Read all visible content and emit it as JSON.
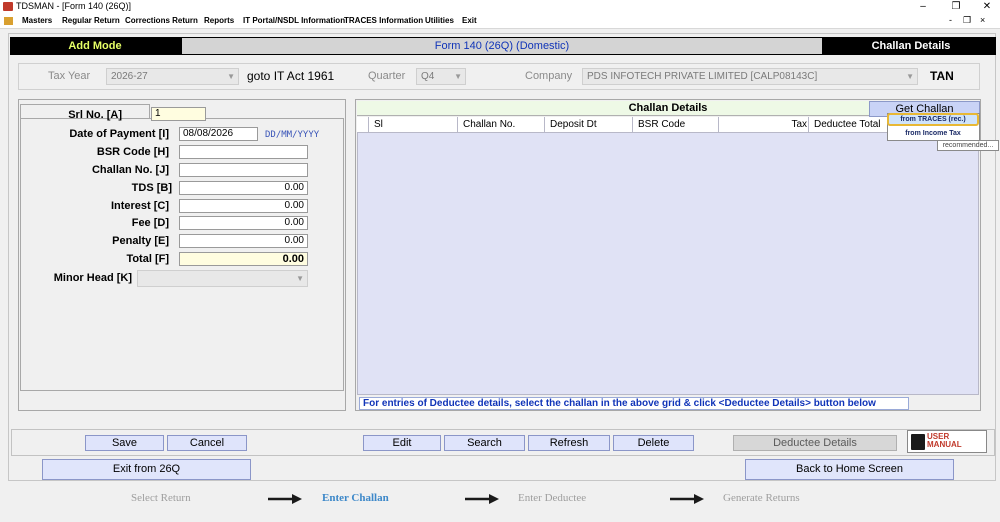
{
  "window": {
    "title": "TDSMAN - [Form 140 (26Q)]",
    "controls": {
      "minimize": "–",
      "restore": "❐",
      "close": "✕"
    },
    "mdi_controls": {
      "minimize": "-",
      "restore": "❐",
      "close": "×"
    }
  },
  "menu": [
    "Masters",
    "Regular Return",
    "Corrections Return",
    "Reports",
    "IT Portal/NSDL Information",
    "TRACES Information",
    "Utilities",
    "Exit"
  ],
  "header": {
    "mode": "Add Mode",
    "form": "Form 140 (26Q) (Domestic)",
    "section": "Challan Details"
  },
  "info": {
    "tax_year_label": "Tax Year",
    "tax_year_value": "2026-27",
    "goto_label": "goto IT Act 1961",
    "quarter_label": "Quarter",
    "quarter_value": "Q4",
    "company_label": "Company",
    "company_value": "PDS INFOTECH PRIVATE LIMITED [CALP08143C]",
    "tan_label": "TAN"
  },
  "form": {
    "srno_label": "Srl No. [A]",
    "srno_value": "1",
    "date_label": "Date of Payment [I]",
    "date_value": "08/08/2026",
    "date_hint": "DD/MM/YYYY",
    "bsr_label": "BSR Code [H]",
    "bsr_value": "",
    "challan_label": "Challan No. [J]",
    "challan_value": "",
    "tds_label": "TDS [B]",
    "tds_value": "0.00",
    "interest_label": "Interest [C]",
    "interest_value": "0.00",
    "fee_label": "Fee [D]",
    "fee_value": "0.00",
    "penalty_label": "Penalty [E]",
    "penalty_value": "0.00",
    "total_label": "Total [F]",
    "total_value": "0.00",
    "minor_label": "Minor Head [K]",
    "minor_value": ""
  },
  "challan_panel": {
    "title": "Challan Details",
    "get_challan": "Get Challan",
    "dropdown": {
      "item1": "from TRACES (rec.)",
      "item2": "from Income Tax",
      "tooltip": "recommended..."
    },
    "columns": [
      "Sl",
      "Challan No.",
      "Deposit Dt",
      "BSR Code",
      "Tax",
      "Deductee Total"
    ],
    "note": "For entries of Deductee details, select the challan in the above grid & click <Deductee Details> button below"
  },
  "buttons": {
    "save": "Save",
    "cancel": "Cancel",
    "edit": "Edit",
    "search": "Search",
    "refresh": "Refresh",
    "delete": "Delete",
    "deductee_details": "Deductee Details",
    "user_manual": "USER MANUAL",
    "exit": "Exit from 26Q",
    "home": "Back to Home Screen"
  },
  "steps": [
    {
      "label": "Select Return",
      "active": false
    },
    {
      "label": "Enter Challan",
      "active": true
    },
    {
      "label": "Enter Deductee",
      "active": false
    },
    {
      "label": "Generate Returns",
      "active": false
    }
  ],
  "colors": {
    "accent_yellow": "#e6ff66",
    "form_blue": "#1034b8",
    "highlight_border": "#e8b835",
    "grid_bg": "#e0e2f5"
  }
}
